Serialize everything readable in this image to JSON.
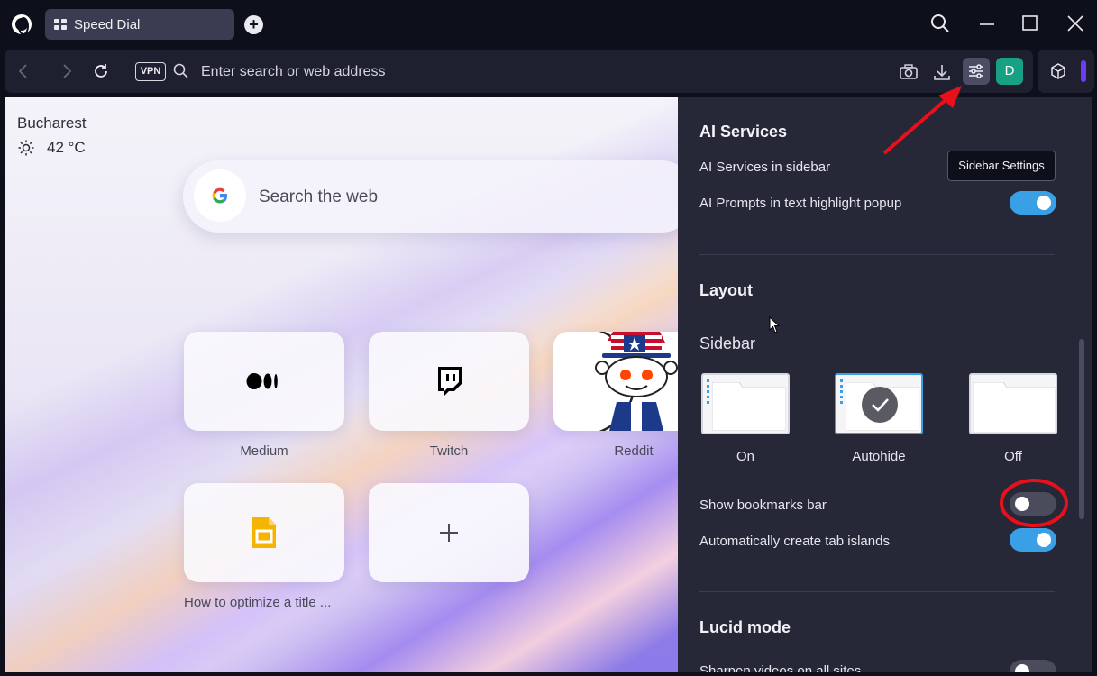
{
  "tab": {
    "label": "Speed Dial"
  },
  "addressbar": {
    "placeholder": "Enter search or web address",
    "vpn_label": "VPN"
  },
  "profile": {
    "initial": "D"
  },
  "tooltip": {
    "text": "Sidebar Settings"
  },
  "weather": {
    "city": "Bucharest",
    "temperature": "42 °C"
  },
  "web_search": {
    "placeholder": "Search the web"
  },
  "speed_dial": {
    "tiles": [
      {
        "label": "Medium"
      },
      {
        "label": "Twitch"
      },
      {
        "label": "Reddit"
      },
      {
        "label": "How to optimize a title ..."
      },
      {
        "label": ""
      }
    ]
  },
  "settings": {
    "ai_services": {
      "title": "AI Services",
      "items": [
        {
          "label": "AI Services in sidebar"
        },
        {
          "label": "AI Prompts in text highlight popup",
          "enabled": true
        }
      ]
    },
    "layout": {
      "title": "Layout",
      "sidebar_heading": "Sidebar",
      "sidebar_options": [
        {
          "label": "On",
          "selected": false
        },
        {
          "label": "Autohide",
          "selected": true
        },
        {
          "label": "Off",
          "selected": false
        }
      ],
      "items": [
        {
          "label": "Show bookmarks bar",
          "enabled": false
        },
        {
          "label": "Automatically create tab islands",
          "enabled": true
        }
      ]
    },
    "lucid_mode": {
      "title": "Lucid mode",
      "items": [
        {
          "label": "Sharpen videos on all sites",
          "enabled": false
        }
      ]
    }
  },
  "colors": {
    "accent": "#39a0e5",
    "avatar": "#17a083",
    "annotation": "#e8101a"
  }
}
